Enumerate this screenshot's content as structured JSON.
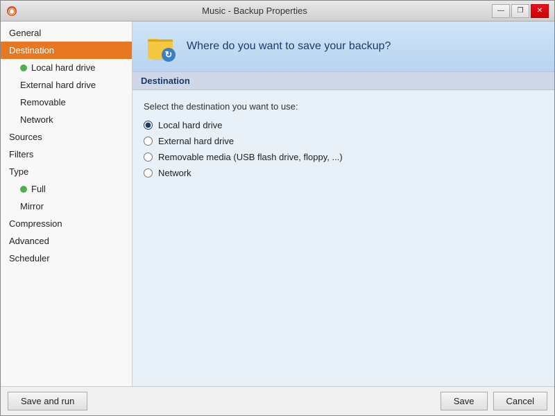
{
  "window": {
    "title": "Music - Backup Properties"
  },
  "titlebar": {
    "minimize_label": "—",
    "restore_label": "❐",
    "close_label": "✕"
  },
  "sidebar": {
    "items": [
      {
        "id": "general",
        "label": "General",
        "indent": false,
        "active": false,
        "has_dot": false
      },
      {
        "id": "destination",
        "label": "Destination",
        "indent": false,
        "active": true,
        "has_dot": false
      },
      {
        "id": "local-hard-drive",
        "label": "Local hard drive",
        "indent": true,
        "active": false,
        "has_dot": true
      },
      {
        "id": "external-hard-drive",
        "label": "External hard drive",
        "indent": true,
        "active": false,
        "has_dot": false
      },
      {
        "id": "removable",
        "label": "Removable",
        "indent": true,
        "active": false,
        "has_dot": false
      },
      {
        "id": "network",
        "label": "Network",
        "indent": true,
        "active": false,
        "has_dot": false
      },
      {
        "id": "sources",
        "label": "Sources",
        "indent": false,
        "active": false,
        "has_dot": false
      },
      {
        "id": "filters",
        "label": "Filters",
        "indent": false,
        "active": false,
        "has_dot": false
      },
      {
        "id": "type",
        "label": "Type",
        "indent": false,
        "active": false,
        "has_dot": false
      },
      {
        "id": "full",
        "label": "Full",
        "indent": true,
        "active": false,
        "has_dot": true
      },
      {
        "id": "mirror",
        "label": "Mirror",
        "indent": true,
        "active": false,
        "has_dot": false
      },
      {
        "id": "compression",
        "label": "Compression",
        "indent": false,
        "active": false,
        "has_dot": false
      },
      {
        "id": "advanced",
        "label": "Advanced",
        "indent": false,
        "active": false,
        "has_dot": false
      },
      {
        "id": "scheduler",
        "label": "Scheduler",
        "indent": false,
        "active": false,
        "has_dot": false
      }
    ]
  },
  "main": {
    "header_question": "Where do you want to save your backup?",
    "section_label": "Destination",
    "subtitle": "Select the destination you want to use:",
    "options": [
      {
        "id": "opt-local",
        "label": "Local hard drive",
        "checked": true
      },
      {
        "id": "opt-external",
        "label": "External hard drive",
        "checked": false
      },
      {
        "id": "opt-removable",
        "label": "Removable media (USB flash drive, floppy, ...)",
        "checked": false
      },
      {
        "id": "opt-network",
        "label": "Network",
        "checked": false
      }
    ]
  },
  "bottom": {
    "save_run_label": "Save and run",
    "save_label": "Save",
    "cancel_label": "Cancel"
  }
}
